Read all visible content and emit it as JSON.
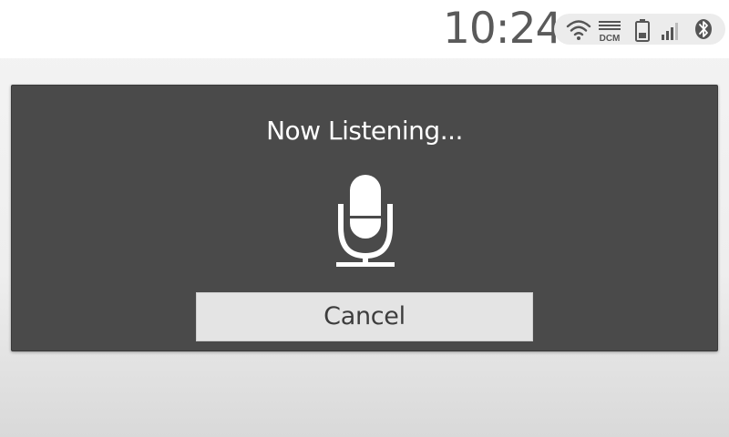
{
  "status_bar": {
    "time": "10:24",
    "indicators": {
      "wifi": "wifi-icon",
      "dcm": {
        "icon": "dcm-icon",
        "label": "DCM"
      },
      "battery": "battery-icon",
      "signal": "signal-bars-icon",
      "bluetooth": "bluetooth-icon"
    }
  },
  "dialog": {
    "title": "Now Listening...",
    "icon": "microphone-icon",
    "cancel_label": "Cancel"
  },
  "colors": {
    "dialog_bg": "#4a4a4a",
    "button_bg": "#e4e4e4",
    "clock_text": "#5a5a5a",
    "status_pill": "#ececec"
  }
}
